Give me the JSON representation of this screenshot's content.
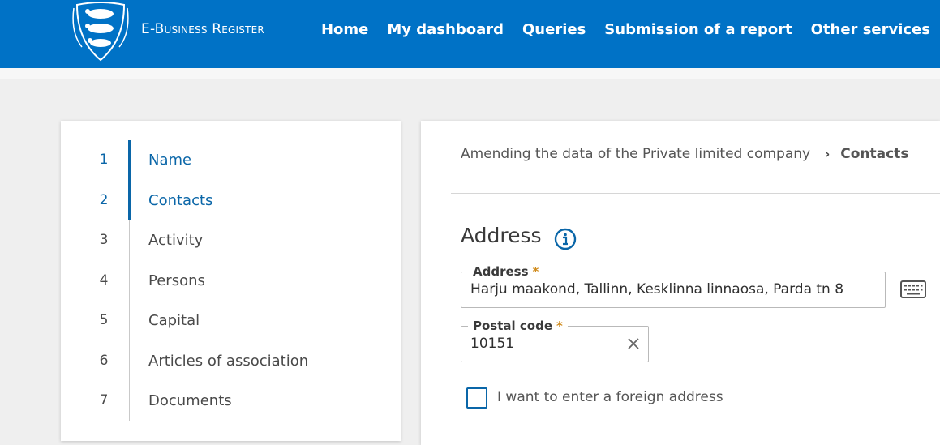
{
  "header": {
    "brand": "E-Business Register",
    "nav": [
      "Home",
      "My dashboard",
      "Queries",
      "Submission of a report",
      "Other services"
    ]
  },
  "steps": [
    {
      "num": "1",
      "label": "Name",
      "active": true
    },
    {
      "num": "2",
      "label": "Contacts",
      "active": true
    },
    {
      "num": "3",
      "label": "Activity",
      "active": false
    },
    {
      "num": "4",
      "label": "Persons",
      "active": false
    },
    {
      "num": "5",
      "label": "Capital",
      "active": false
    },
    {
      "num": "6",
      "label": "Articles of association",
      "active": false
    },
    {
      "num": "7",
      "label": "Documents",
      "active": false
    }
  ],
  "breadcrumb": {
    "parent": "Amending the data of the Private limited company",
    "separator": "›",
    "current": "Contacts"
  },
  "section": {
    "title": "Address",
    "info_icon": "info-circle-icon"
  },
  "address_field": {
    "label": "Address",
    "required_mark": "*",
    "value": "Harju maakond, Tallinn, Kesklinna linnaosa, Parda tn 8"
  },
  "postal_field": {
    "label": "Postal code",
    "required_mark": "*",
    "value": "10151"
  },
  "foreign_checkbox": {
    "label": "I want to enter a foreign address",
    "checked": false
  },
  "colors": {
    "header_bg": "#0072c6",
    "accent": "#0a66a8",
    "required": "#d08a1a"
  }
}
